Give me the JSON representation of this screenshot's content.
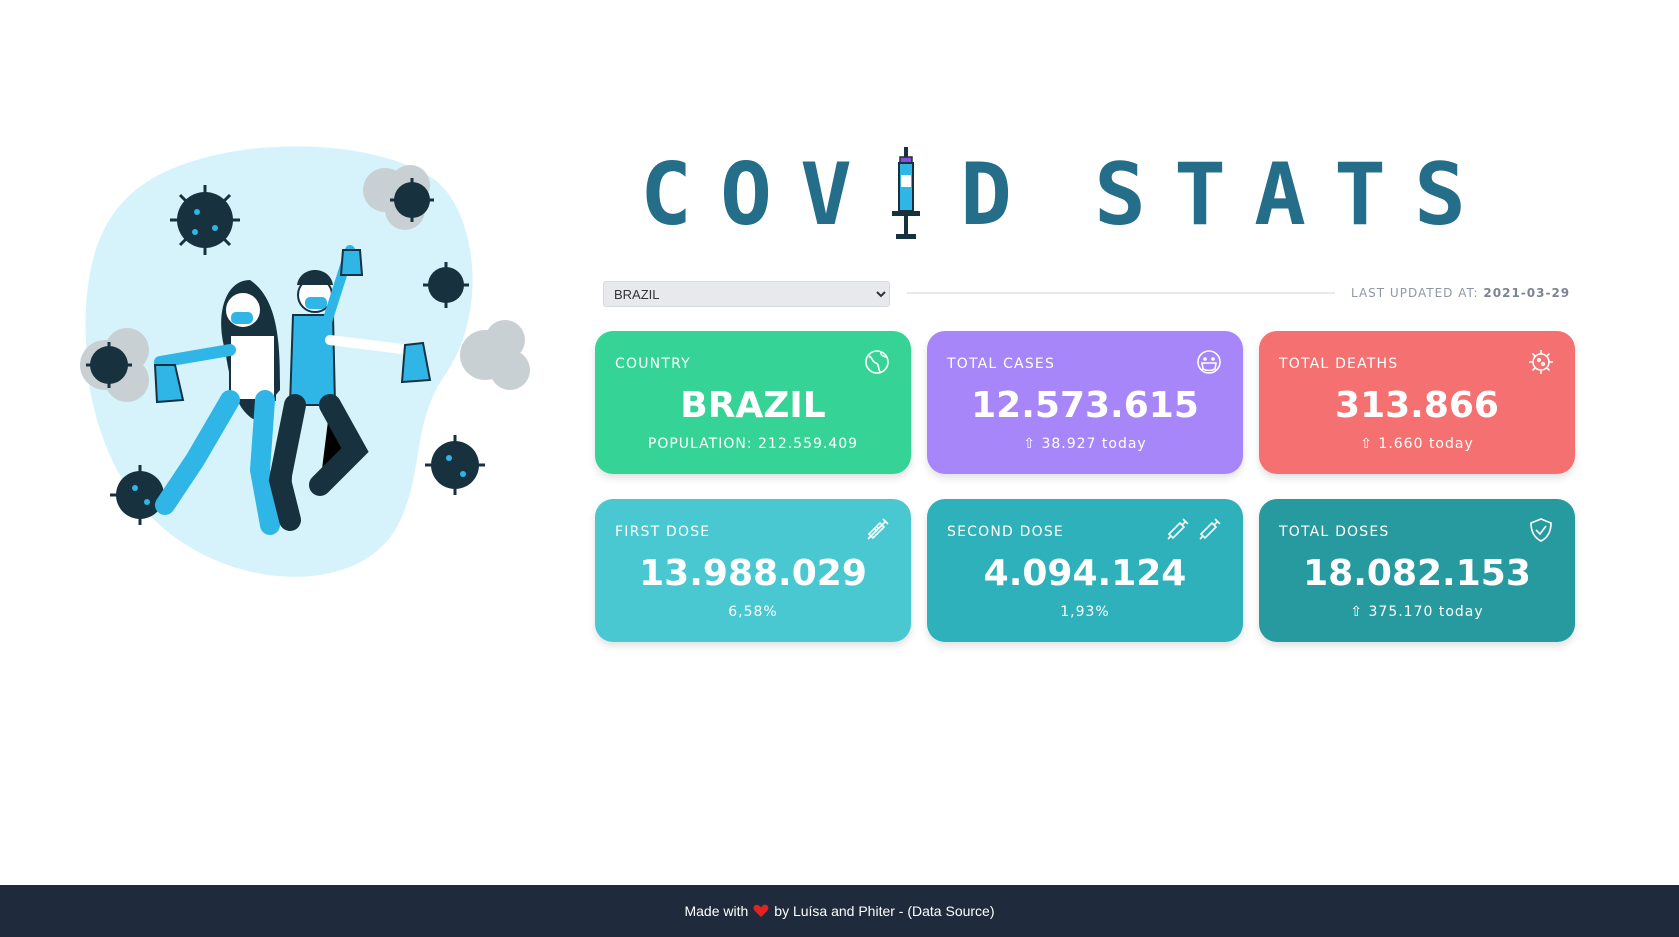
{
  "header": {
    "title_left": [
      "C",
      "O",
      "V"
    ],
    "title_right": [
      "D"
    ],
    "title_word2": [
      "S",
      "T",
      "A",
      "T",
      "S"
    ]
  },
  "controls": {
    "country_select": {
      "selected": "BRAZIL",
      "options": [
        "BRAZIL"
      ]
    },
    "last_updated_label": "LAST UPDATED AT:",
    "last_updated_date": "2021-03-29"
  },
  "cards": {
    "country": {
      "label": "COUNTRY",
      "value": "BRAZIL",
      "sub": "POPULATION: 212.559.409",
      "icon": "globe-icon"
    },
    "total_cases": {
      "label": "TOTAL CASES",
      "value": "12.573.615",
      "sub": "⇧ 38.927 today",
      "icon": "masked-face-icon"
    },
    "total_deaths": {
      "label": "TOTAL DEATHS",
      "value": "313.866",
      "sub": "⇧ 1.660 today",
      "icon": "virus-icon"
    },
    "first_dose": {
      "label": "FIRST DOSE",
      "value": "13.988.029",
      "sub": "6,58%",
      "icon": "syringe-icon"
    },
    "second_dose": {
      "label": "SECOND DOSE",
      "value": "4.094.124",
      "sub": "1,93%",
      "icon": "double-syringe-icon"
    },
    "total_doses": {
      "label": "TOTAL DOSES",
      "value": "18.082.153",
      "sub": "⇧ 375.170 today",
      "icon": "shield-check-icon"
    }
  },
  "colors": {
    "title": "#246e8a",
    "country": "#35d496",
    "total_cases": "#a686f8",
    "total_deaths": "#f57070",
    "first_dose": "#4ac8d2",
    "second_dose": "#2eb1ba",
    "total_doses": "#279a9f",
    "footer_bg": "#1f2b3c"
  },
  "footer": {
    "made_with": "Made with",
    "by_text": "by Luísa and Phiter - (Data Source)"
  }
}
